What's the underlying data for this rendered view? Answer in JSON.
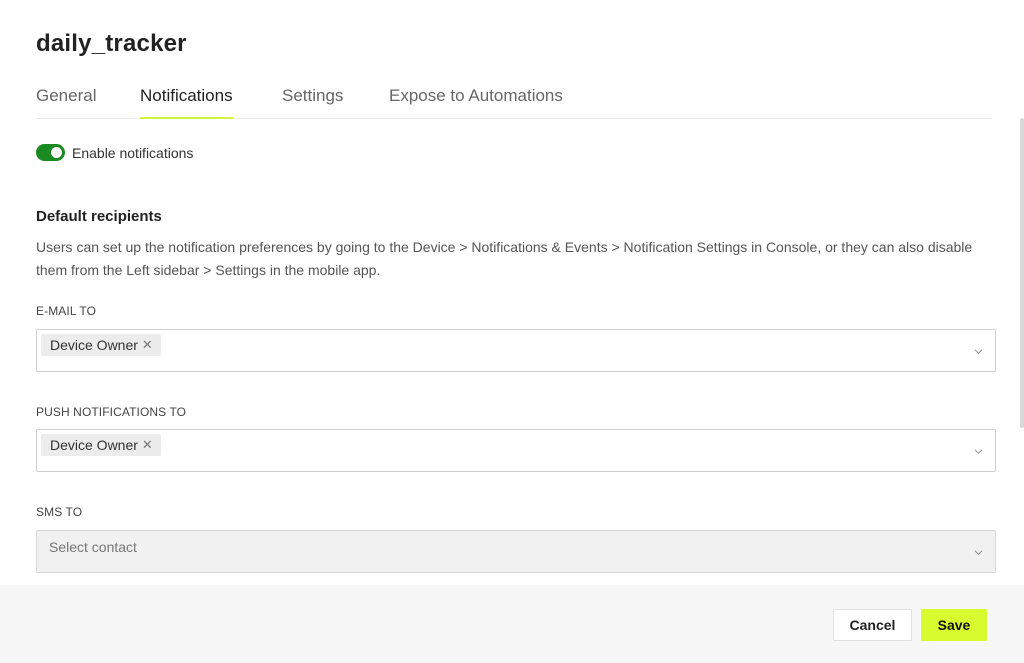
{
  "page": {
    "title": "daily_tracker"
  },
  "tabs": [
    {
      "label": "General",
      "active": false
    },
    {
      "label": "Notifications",
      "active": true
    },
    {
      "label": "Settings",
      "active": false
    },
    {
      "label": "Expose to Automations",
      "active": false
    }
  ],
  "notifications": {
    "enable_label": "Enable notifications",
    "enabled": true
  },
  "recipients": {
    "title": "Default recipients",
    "description": "Users can set up the notification preferences by going to the Device > Notifications & Events > Notification Settings in Console, or they can also disable them from the Left sidebar > Settings in the mobile app.",
    "email": {
      "label": "E-MAIL TO",
      "chips": [
        "Device Owner"
      ]
    },
    "push": {
      "label": "PUSH NOTIFICATIONS TO",
      "chips": [
        "Device Owner"
      ]
    },
    "sms": {
      "label": "SMS TO",
      "placeholder": "Select contact"
    }
  },
  "footer": {
    "cancel_label": "Cancel",
    "save_label": "Save"
  },
  "colors": {
    "accent": "#d7fb2e",
    "toggle_on": "#1c8a22",
    "footer_bg": "#f7f7f7"
  },
  "icons": {
    "chip_remove": "close-icon",
    "dropdown": "chevron-down-icon"
  }
}
